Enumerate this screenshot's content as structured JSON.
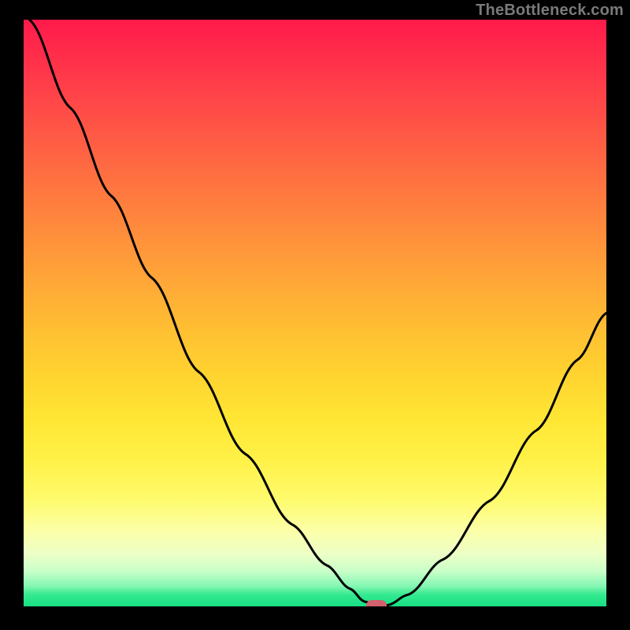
{
  "watermark": "TheBottleneck.com",
  "chart_data": {
    "type": "line",
    "title": "",
    "xlabel": "",
    "ylabel": "",
    "xlim": [
      0,
      1
    ],
    "ylim": [
      0,
      1
    ],
    "grid": false,
    "legend": false,
    "series": [
      {
        "name": "bottleneck-curve",
        "color": "#000000",
        "x": [
          0.01,
          0.08,
          0.15,
          0.22,
          0.3,
          0.38,
          0.46,
          0.52,
          0.56,
          0.585,
          0.605,
          0.625,
          0.66,
          0.72,
          0.8,
          0.88,
          0.95,
          1.0
        ],
        "y": [
          1.0,
          0.85,
          0.7,
          0.56,
          0.4,
          0.26,
          0.14,
          0.07,
          0.03,
          0.008,
          0.002,
          0.002,
          0.02,
          0.08,
          0.18,
          0.3,
          0.42,
          0.5
        ]
      }
    ],
    "annotations": [
      {
        "name": "optimal-marker",
        "x": 0.605,
        "y": 0.002,
        "shape": "pill",
        "color": "#d2616d"
      }
    ],
    "background_gradient": {
      "direction": "vertical",
      "stops": [
        {
          "pos": 0.0,
          "color": "#ff1a4b"
        },
        {
          "pos": 0.5,
          "color": "#ffd22f"
        },
        {
          "pos": 0.82,
          "color": "#fffb6e"
        },
        {
          "pos": 1.0,
          "color": "#17e085"
        }
      ]
    }
  }
}
